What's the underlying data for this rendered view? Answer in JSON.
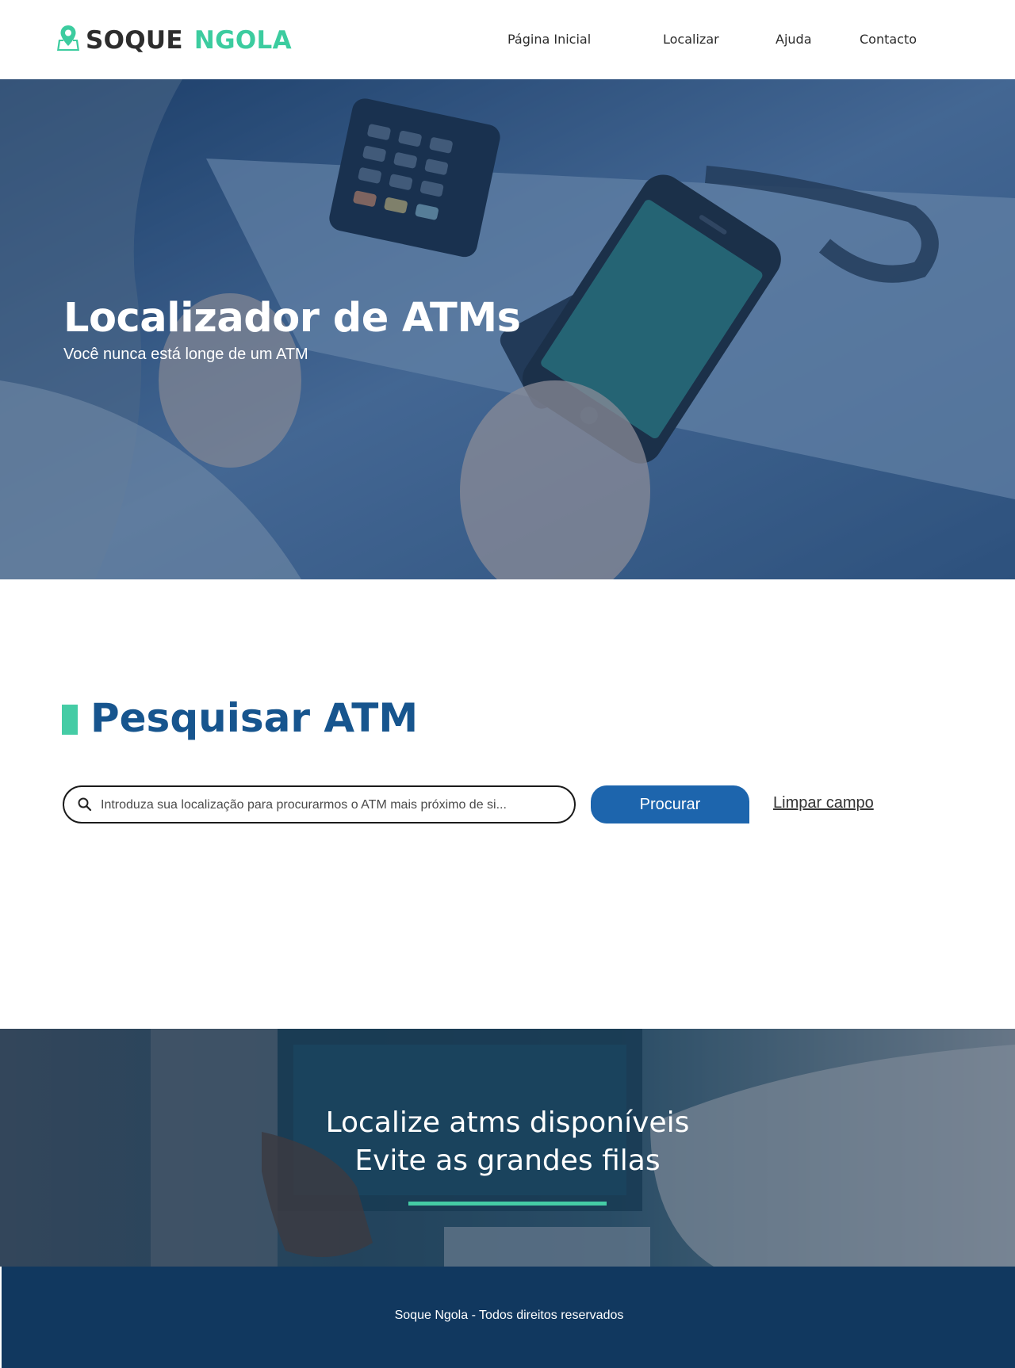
{
  "header": {
    "logo_part1": "SOQUE",
    "logo_part2": "NGOLA",
    "nav": [
      {
        "label": "Página Inicial"
      },
      {
        "label": "Localizar"
      },
      {
        "label": "Ajuda"
      },
      {
        "label": "Contacto"
      }
    ]
  },
  "hero": {
    "title": "Localizador de ATMs",
    "subtitle": "Você nunca está longe de um ATM"
  },
  "search": {
    "title": "Pesquisar ATM",
    "placeholder": "Introduza sua localização para procurarmos o ATM mais próximo de si...",
    "button_label": "Procurar",
    "clear_label": "Limpar campo"
  },
  "banner": {
    "line1": "Localize atms disponíveis",
    "line2": "Evite as grandes filas"
  },
  "footer": {
    "text": "Soque Ngola - Todos direitos reservados"
  },
  "colors": {
    "brand_green": "#3ccc9f",
    "brand_blue": "#17558e",
    "button_blue": "#1d65ad",
    "footer_navy": "#11385f"
  }
}
